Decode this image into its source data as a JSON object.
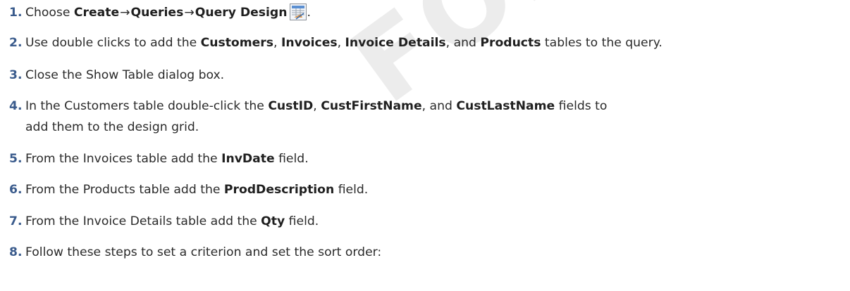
{
  "watermark": "FOR REVIEW ONLY",
  "steps": [
    {
      "num": "1.",
      "parts": {
        "a": "Choose ",
        "b1": "Create",
        "arrow1": "→",
        "b2": "Queries",
        "arrow2": "→",
        "b3": "Query Design",
        "end": "."
      },
      "icon": "query-design-icon"
    },
    {
      "num": "2.",
      "parts": {
        "a": "Use double clicks to add the ",
        "b1": "Customers",
        "c1": ", ",
        "b2": "Invoices",
        "c2": ", ",
        "b3": "Invoice Details",
        "c3": ", and ",
        "b4": "Products",
        "end": " tables to the query."
      }
    },
    {
      "num": "3.",
      "text": "Close the Show Table dialog box."
    },
    {
      "num": "4.",
      "parts": {
        "a": "In the Customers table double-click the ",
        "b1": "CustID",
        "c1": ", ",
        "b2": "CustFirstName",
        "c2": ", and ",
        "b3": "CustLastName",
        "end": " fields to"
      },
      "continuation": "add them to the design grid."
    },
    {
      "num": "5.",
      "parts": {
        "a": "From the Invoices table add the ",
        "b1": "InvDate",
        "end": " field."
      }
    },
    {
      "num": "6.",
      "parts": {
        "a": "From the Products table add the ",
        "b1": "ProdDescription",
        "end": " field."
      }
    },
    {
      "num": "7.",
      "parts": {
        "a": "From the Invoice Details table add the ",
        "b1": "Qty",
        "end": " field."
      }
    },
    {
      "num": "8.",
      "text": "Follow these steps to set a criterion and set the sort order:"
    }
  ]
}
